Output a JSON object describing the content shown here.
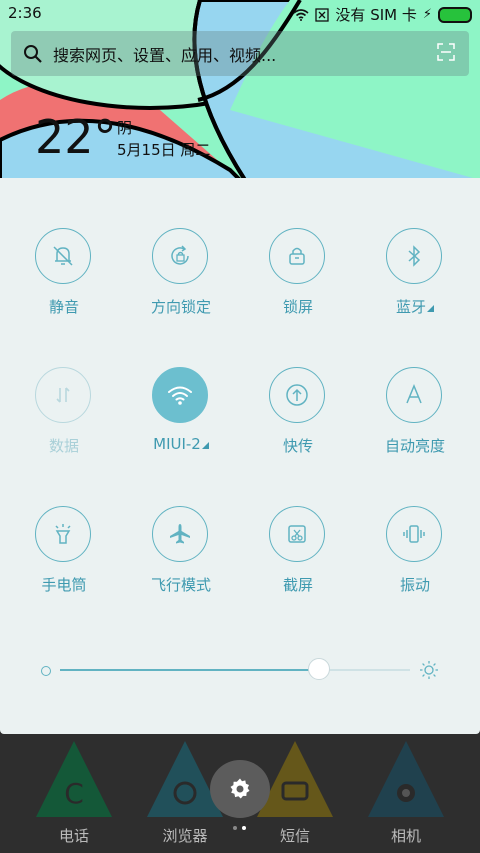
{
  "status_bar": {
    "time": "2:36",
    "carrier": "没有 SIM 卡",
    "battery_color": "#27c23c"
  },
  "search": {
    "placeholder": "搜索网页、设置、应用、视频..."
  },
  "weather": {
    "temperature": "22°",
    "condition": "阴",
    "date": "5月15日 周二"
  },
  "toggles": [
    {
      "label": "静音",
      "icon": "bell-off-icon",
      "state": "off"
    },
    {
      "label": "方向锁定",
      "icon": "rotation-lock-icon",
      "state": "off"
    },
    {
      "label": "锁屏",
      "icon": "lock-icon",
      "state": "off"
    },
    {
      "label": "蓝牙",
      "icon": "bluetooth-icon",
      "state": "off"
    },
    {
      "label": "数据",
      "icon": "data-arrows-icon",
      "state": "disabled"
    },
    {
      "label": "MIUI-2",
      "icon": "wifi-icon",
      "state": "on"
    },
    {
      "label": "快传",
      "icon": "upload-icon",
      "state": "off"
    },
    {
      "label": "自动亮度",
      "icon": "auto-brightness-icon",
      "state": "off"
    },
    {
      "label": "手电筒",
      "icon": "flashlight-icon",
      "state": "off"
    },
    {
      "label": "飞行模式",
      "icon": "airplane-icon",
      "state": "off"
    },
    {
      "label": "截屏",
      "icon": "screenshot-icon",
      "state": "off"
    },
    {
      "label": "振动",
      "icon": "vibrate-icon",
      "state": "off"
    }
  ],
  "brightness": {
    "level": 0.74
  },
  "dock": [
    {
      "label": "电话",
      "color": "#0a6b3d"
    },
    {
      "label": "浏览器",
      "color": "#1c5f6e"
    },
    {
      "label": "短信",
      "color": "#7d6a12"
    },
    {
      "label": "相机",
      "color": "#1b4a5c"
    }
  ],
  "colors": {
    "accent": "#61b3c2",
    "panel_bg": "#ebf2f2",
    "wallpaper_green": "#8ef5c6",
    "wallpaper_blue": "#97d6f0",
    "wallpaper_red": "#f07272"
  }
}
